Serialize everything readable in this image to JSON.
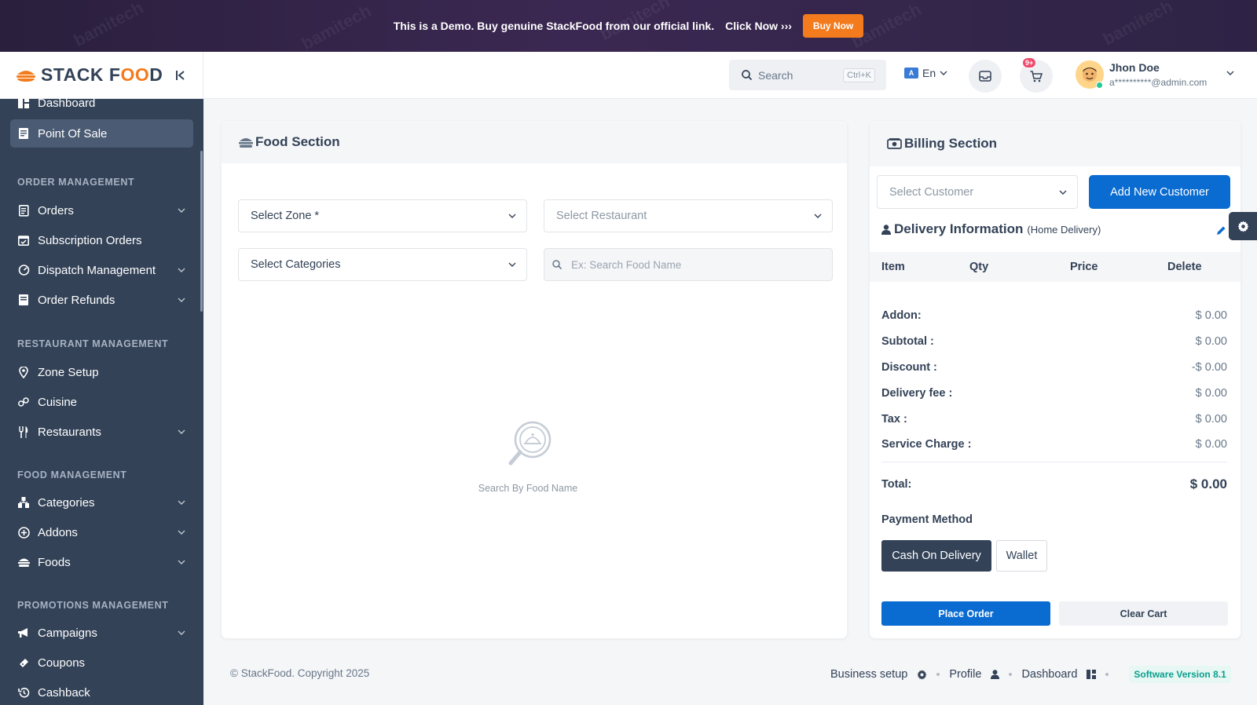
{
  "banner": {
    "text": "This is a Demo. Buy genuine StackFood from our official link.",
    "click_now": "Click Now",
    "buy_now": "Buy Now"
  },
  "brand": {
    "name_start": "STACK F",
    "name_o": "OO",
    "name_end": "D",
    "accent": "#f37b1d"
  },
  "sidebar": {
    "items": [
      {
        "label": "Dashboard",
        "icon": "dashboard-icon"
      },
      {
        "label": "Point Of Sale",
        "icon": "pos-icon"
      },
      {
        "label": "Orders",
        "icon": "orders-icon"
      },
      {
        "label": "Subscription Orders",
        "icon": "calendar-icon"
      },
      {
        "label": "Dispatch Management",
        "icon": "dispatch-icon"
      },
      {
        "label": "Order Refunds",
        "icon": "refund-icon"
      },
      {
        "label": "Zone Setup",
        "icon": "location-icon"
      },
      {
        "label": "Cuisine",
        "icon": "link-icon"
      },
      {
        "label": "Restaurants",
        "icon": "fork-knife-icon"
      },
      {
        "label": "Categories",
        "icon": "categories-icon"
      },
      {
        "label": "Addons",
        "icon": "plus-circle-icon"
      },
      {
        "label": "Foods",
        "icon": "burger-icon"
      },
      {
        "label": "Campaigns",
        "icon": "megaphone-icon"
      },
      {
        "label": "Coupons",
        "icon": "ticket-icon"
      },
      {
        "label": "Cashback",
        "icon": "history-icon"
      }
    ],
    "headings": [
      "ORDER MANAGEMENT",
      "RESTAURANT MANAGEMENT",
      "FOOD MANAGEMENT",
      "PROMOTIONS MANAGEMENT"
    ]
  },
  "header": {
    "search_placeholder": "Search",
    "search_shortcut": "Ctrl+K",
    "language": "En",
    "cart_badge": "9+",
    "user_name": "Jhon Doe",
    "user_email": "a**********@admin.com"
  },
  "food_section": {
    "title": "Food Section",
    "zone": "Select Zone *",
    "restaurant": "Select Restaurant",
    "categories": "Select Categories",
    "search_placeholder": "Ex: Search Food Name",
    "empty_text": "Search By Food Name"
  },
  "billing": {
    "title": "Billing Section",
    "customer": "Select Customer",
    "add_customer": "Add New Customer",
    "delivery_title": "Delivery Information",
    "delivery_type": "(Home Delivery)",
    "columns": [
      "Item",
      "Qty",
      "Price",
      "Delete"
    ],
    "rows": [
      {
        "label": "Addon:",
        "value": "$ 0.00"
      },
      {
        "label": "Subtotal :",
        "value": "$ 0.00"
      },
      {
        "label": "Discount :",
        "value": "-$ 0.00"
      },
      {
        "label": "Delivery fee :",
        "value": "$ 0.00"
      },
      {
        "label": "Tax :",
        "value": "$ 0.00"
      },
      {
        "label": "Service Charge :",
        "value": "$ 0.00"
      }
    ],
    "total_label": "Total:",
    "total_value": "$ 0.00",
    "payment_label": "Payment Method",
    "cod": "Cash On Delivery",
    "wallet": "Wallet",
    "place_order": "Place Order",
    "clear_cart": "Clear Cart"
  },
  "footer": {
    "copyright": "© StackFood. Copyright 2025",
    "business_setup": "Business setup",
    "profile": "Profile",
    "dashboard": "Dashboard",
    "version": "Software Version 8.1"
  }
}
